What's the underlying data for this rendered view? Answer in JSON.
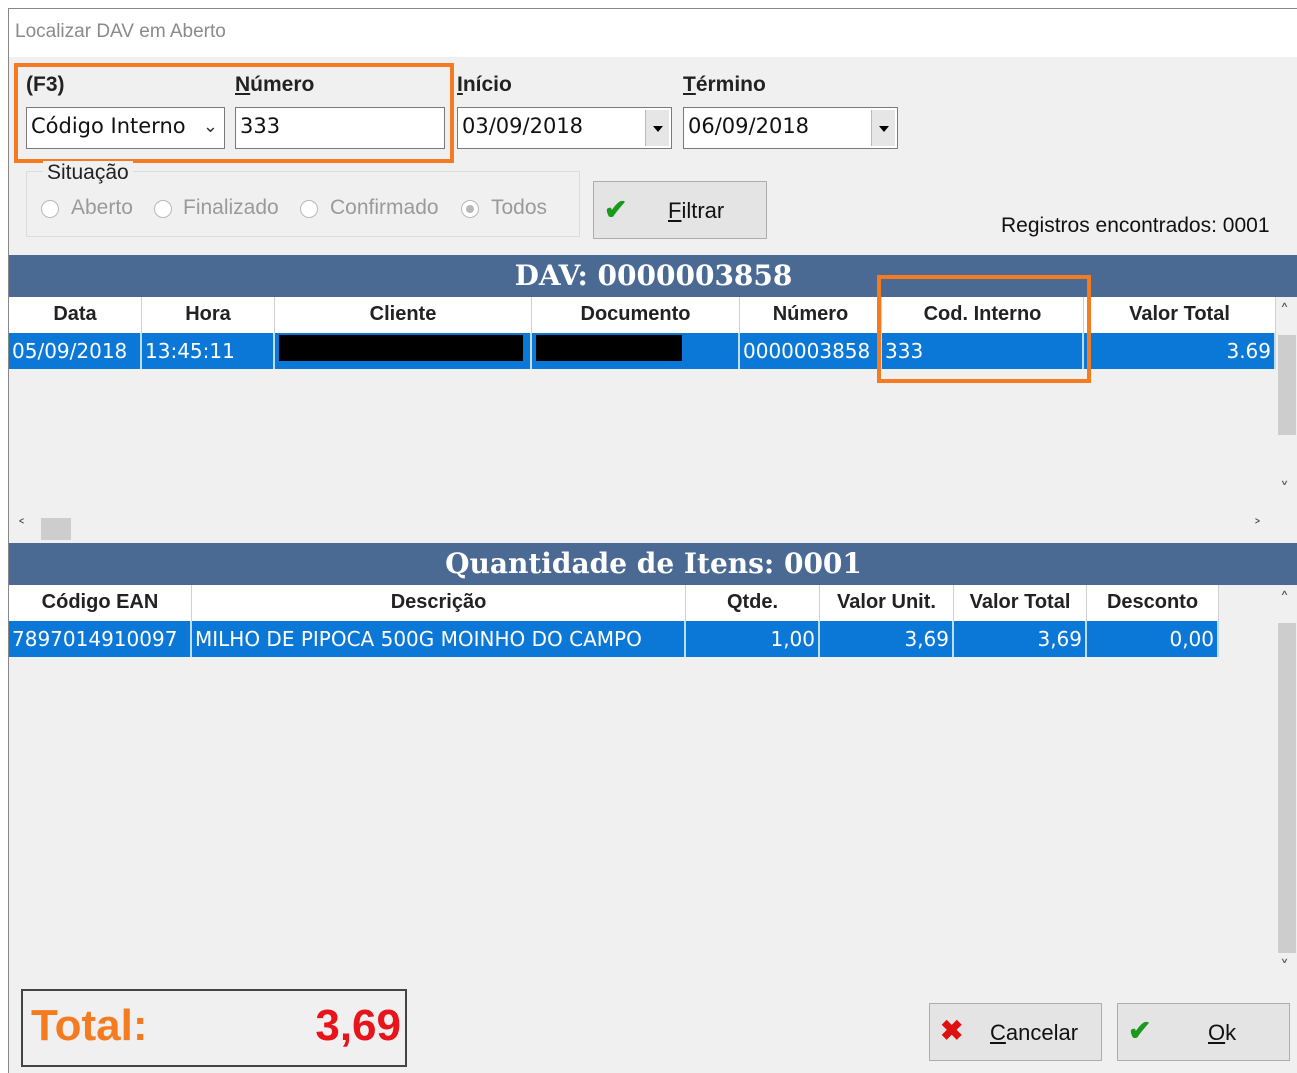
{
  "window": {
    "title": "Localizar DAV em Aberto"
  },
  "search": {
    "type_label": "(F3)",
    "type_value": "Código Interno",
    "numero_label": "Número",
    "numero_value": "333",
    "inicio_label": "Início",
    "inicio_value": "03/09/2018",
    "termino_label": "Término",
    "termino_value": "06/09/2018"
  },
  "situacao": {
    "label": "Situação",
    "options": [
      "Aberto",
      "Finalizado",
      "Confirmado",
      "Todos"
    ],
    "selected": "Todos"
  },
  "filtrar_label": "Filtrar",
  "registros": "Registros encontrados: 0001",
  "dav_banner": "DAV: 0000003858",
  "dav_table": {
    "columns": [
      "Data",
      "Hora",
      "Cliente",
      "Documento",
      "Número",
      "Cod. Interno",
      "Valor Total"
    ],
    "rows": [
      {
        "data": "05/09/2018",
        "hora": "13:45:11",
        "cliente": "",
        "documento": "",
        "numero": "0000003858",
        "cod_interno": "333",
        "valor_total": "3.69"
      }
    ]
  },
  "itens_banner": "Quantidade de Itens: 0001",
  "itens_table": {
    "columns": [
      "Código EAN",
      "Descrição",
      "Qtde.",
      "Valor Unit.",
      "Valor Total",
      "Desconto"
    ],
    "rows": [
      {
        "ean": "7897014910097",
        "descricao": "MILHO DE PIPOCA 500G MOINHO DO CAMPO",
        "qtde": "1,00",
        "valor_unit": "3,69",
        "valor_total": "3,69",
        "desconto": "0,00"
      }
    ]
  },
  "total": {
    "label": "Total:",
    "value": "3,69"
  },
  "buttons": {
    "cancelar": "Cancelar",
    "ok": "Ok"
  },
  "colors": {
    "highlight": "#f47b20",
    "banner": "#4a6a94",
    "selection": "#0b78d7",
    "total_label": "#f47b20",
    "total_value": "#e8141c"
  },
  "icons": [
    "chevron-down-icon",
    "check-icon",
    "x-icon",
    "scroll-up-icon",
    "scroll-down-icon",
    "scroll-left-icon",
    "scroll-right-icon"
  ]
}
